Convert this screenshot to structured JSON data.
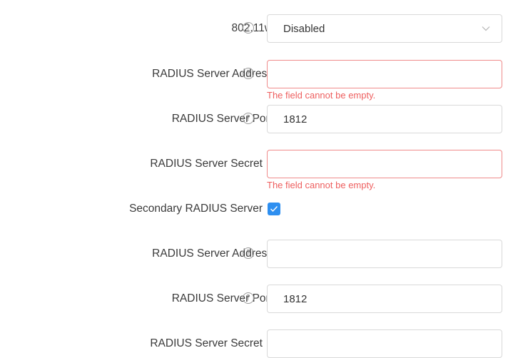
{
  "form": {
    "pmf": {
      "label": "802.11w",
      "value": "Disabled",
      "help_icon": "question-circle-icon",
      "chevron_icon": "chevron-down-icon"
    },
    "radius_address": {
      "label": "RADIUS Server Address",
      "value": "",
      "error": "The field cannot be empty.",
      "help_icon": "question-circle-icon"
    },
    "radius_port": {
      "label": "RADIUS Server Port",
      "value": "1812",
      "help_icon": "question-circle-icon"
    },
    "radius_secret": {
      "label": "RADIUS Server Secret",
      "value": "",
      "error": "The field cannot be empty."
    },
    "secondary_radius": {
      "label": "Secondary RADIUS Server",
      "checked": true,
      "check_icon": "check-icon"
    },
    "secondary_address": {
      "label": "RADIUS Server Address",
      "value": "",
      "help_icon": "question-circle-icon"
    },
    "secondary_port": {
      "label": "RADIUS Server Port",
      "value": "1812",
      "help_icon": "question-circle-icon"
    },
    "secondary_secret": {
      "label": "RADIUS Server Secret",
      "value": ""
    }
  },
  "colors": {
    "error": "#ee5f5f",
    "error_border": "#f08b8b",
    "accent": "#2e8ff0",
    "border": "#d9d9d9"
  }
}
